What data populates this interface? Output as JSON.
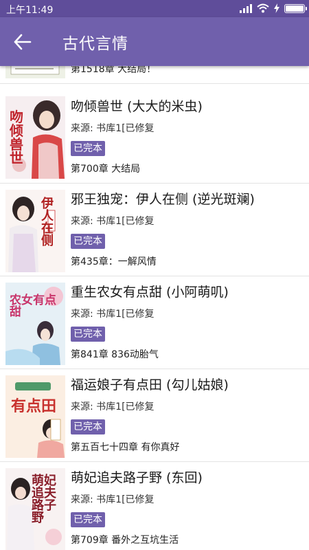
{
  "status_bar": {
    "time": "上午11:49"
  },
  "app_bar": {
    "back_icon": "arrow-left-icon",
    "title": "古代言情"
  },
  "theme": {
    "primary": "#7060ac",
    "status": "#5f4d9a"
  },
  "books": [
    {
      "title": "",
      "source": "",
      "status": "",
      "chapter": "第1518章 大结局！"
    },
    {
      "title": "吻倾兽世 (大大的米虫)",
      "source": "来源: 书库1[已修复",
      "status": "已完本",
      "chapter": "第700章 大结局"
    },
    {
      "title": "邪王独宠：伊人在侧 (逆光斑斓)",
      "source": "来源: 书库1[已修复",
      "status": "已完本",
      "chapter": "第435章：一解风情"
    },
    {
      "title": "重生农女有点甜 (小阿萌叽)",
      "source": "来源: 书库1[已修复",
      "status": "已完本",
      "chapter": "第841章 836动胎气"
    },
    {
      "title": "福运娘子有点田 (勾儿姑娘)",
      "source": "来源: 书库1[已修复",
      "status": "已完本",
      "chapter": "第五百七十四章 有你真好"
    },
    {
      "title": "萌妃追夫路子野 (东回)",
      "source": "来源: 书库1[已修复",
      "status": "已完本",
      "chapter": "第709章 番外之互坑生活"
    }
  ],
  "covers": [
    {
      "text": ""
    },
    {
      "text": "吻倾兽世"
    },
    {
      "text": "伊人在侧"
    },
    {
      "text": "农女有点甜"
    },
    {
      "text": "有点田"
    },
    {
      "text": "萌妃追夫路子野"
    }
  ]
}
